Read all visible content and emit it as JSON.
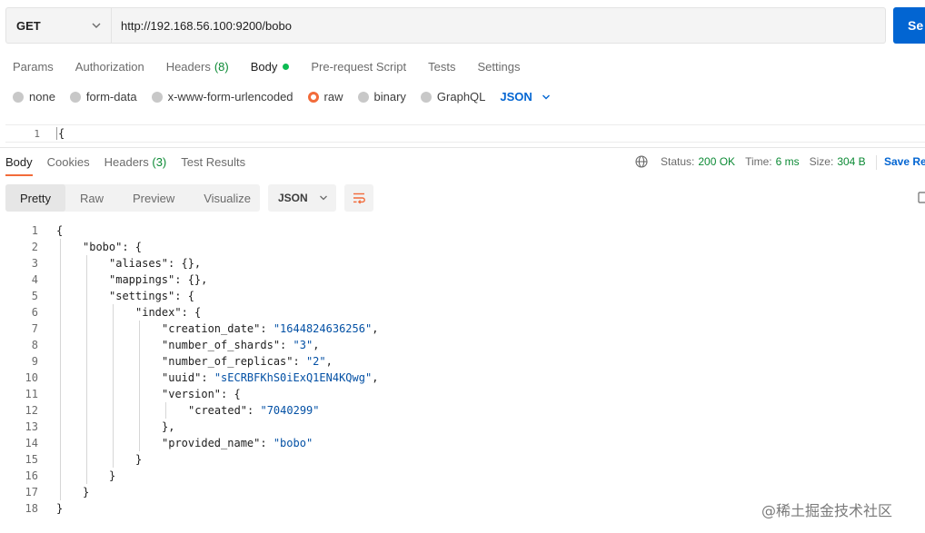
{
  "request": {
    "method": "GET",
    "url": "http://192.168.56.100:9200/bobo",
    "send_label": "Se"
  },
  "request_tabs": [
    {
      "label": "Params"
    },
    {
      "label": "Authorization"
    },
    {
      "label": "Headers",
      "count": "(8)"
    },
    {
      "label": "Body",
      "active": true
    },
    {
      "label": "Pre-request Script"
    },
    {
      "label": "Tests"
    },
    {
      "label": "Settings"
    }
  ],
  "body_types": [
    "none",
    "form-data",
    "x-www-form-urlencoded",
    "raw",
    "binary",
    "GraphQL"
  ],
  "body_type_selected": "raw",
  "body_format": "JSON",
  "request_editor": {
    "line": "1",
    "text": "{"
  },
  "response_tabs": [
    {
      "label": "Body",
      "active": true
    },
    {
      "label": "Cookies"
    },
    {
      "label": "Headers",
      "count": "(3)"
    },
    {
      "label": "Test Results"
    }
  ],
  "status": {
    "status_label": "Status:",
    "status_value": "200 OK",
    "time_label": "Time:",
    "time_value": "6 ms",
    "size_label": "Size:",
    "size_value": "304 B",
    "save_label": "Save Re"
  },
  "view_modes": [
    "Pretty",
    "Raw",
    "Preview",
    "Visualize"
  ],
  "view_format": "JSON",
  "response_lines": [
    {
      "n": "1",
      "indent": 0,
      "parts": [
        [
          "p",
          "{"
        ]
      ]
    },
    {
      "n": "2",
      "indent": 1,
      "parts": [
        [
          "k",
          "\"bobo\""
        ],
        [
          "p",
          ": {"
        ]
      ]
    },
    {
      "n": "3",
      "indent": 2,
      "parts": [
        [
          "k",
          "\"aliases\""
        ],
        [
          "p",
          ": {},"
        ]
      ]
    },
    {
      "n": "4",
      "indent": 2,
      "parts": [
        [
          "k",
          "\"mappings\""
        ],
        [
          "p",
          ": {},"
        ]
      ]
    },
    {
      "n": "5",
      "indent": 2,
      "parts": [
        [
          "k",
          "\"settings\""
        ],
        [
          "p",
          ": {"
        ]
      ]
    },
    {
      "n": "6",
      "indent": 3,
      "parts": [
        [
          "k",
          "\"index\""
        ],
        [
          "p",
          ": {"
        ]
      ]
    },
    {
      "n": "7",
      "indent": 4,
      "parts": [
        [
          "k",
          "\"creation_date\""
        ],
        [
          "p",
          ": "
        ],
        [
          "s",
          "\"1644824636256\""
        ],
        [
          "p",
          ","
        ]
      ]
    },
    {
      "n": "8",
      "indent": 4,
      "parts": [
        [
          "k",
          "\"number_of_shards\""
        ],
        [
          "p",
          ": "
        ],
        [
          "s",
          "\"3\""
        ],
        [
          "p",
          ","
        ]
      ]
    },
    {
      "n": "9",
      "indent": 4,
      "parts": [
        [
          "k",
          "\"number_of_replicas\""
        ],
        [
          "p",
          ": "
        ],
        [
          "s",
          "\"2\""
        ],
        [
          "p",
          ","
        ]
      ]
    },
    {
      "n": "10",
      "indent": 4,
      "parts": [
        [
          "k",
          "\"uuid\""
        ],
        [
          "p",
          ": "
        ],
        [
          "s",
          "\"sECRBFKhS0iExQ1EN4KQwg\""
        ],
        [
          "p",
          ","
        ]
      ]
    },
    {
      "n": "11",
      "indent": 4,
      "parts": [
        [
          "k",
          "\"version\""
        ],
        [
          "p",
          ": {"
        ]
      ]
    },
    {
      "n": "12",
      "indent": 5,
      "parts": [
        [
          "k",
          "\"created\""
        ],
        [
          "p",
          ": "
        ],
        [
          "s",
          "\"7040299\""
        ]
      ]
    },
    {
      "n": "13",
      "indent": 4,
      "parts": [
        [
          "p",
          "},"
        ]
      ]
    },
    {
      "n": "14",
      "indent": 4,
      "parts": [
        [
          "k",
          "\"provided_name\""
        ],
        [
          "p",
          ": "
        ],
        [
          "s",
          "\"bobo\""
        ]
      ]
    },
    {
      "n": "15",
      "indent": 3,
      "parts": [
        [
          "p",
          "}"
        ]
      ]
    },
    {
      "n": "16",
      "indent": 2,
      "parts": [
        [
          "p",
          "}"
        ]
      ]
    },
    {
      "n": "17",
      "indent": 1,
      "parts": [
        [
          "p",
          "}"
        ]
      ]
    },
    {
      "n": "18",
      "indent": 0,
      "parts": [
        [
          "p",
          "}"
        ]
      ]
    }
  ],
  "watermark": "@稀土掘金技术社区",
  "colors": {
    "accent_blue": "#0265d2",
    "accent_orange": "#f26b3a",
    "success_green": "#0c8a35",
    "string_blue": "#0451a5"
  }
}
